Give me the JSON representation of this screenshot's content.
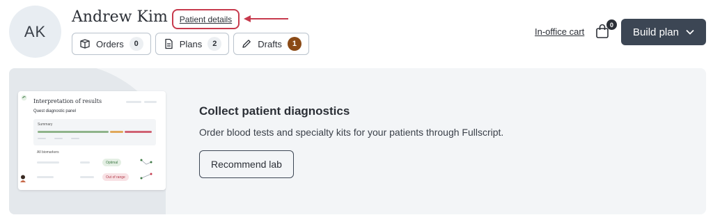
{
  "patient": {
    "initials": "AK",
    "name": "Andrew Kim",
    "details_link": "Patient details"
  },
  "tabs": [
    {
      "label": "Orders",
      "count": "0",
      "icon": "box-icon"
    },
    {
      "label": "Plans",
      "count": "2",
      "icon": "document-icon"
    },
    {
      "label": "Drafts",
      "count": "1",
      "icon": "pencil-icon"
    }
  ],
  "header": {
    "cart_label": "In-office cart",
    "cart_count": "0",
    "build_plan_label": "Build plan"
  },
  "banner": {
    "title": "Collect patient diagnostics",
    "description": "Order blood tests and specialty kits for your patients through Fullscript.",
    "button_label": "Recommend lab",
    "preview": {
      "title": "Interpretation of results",
      "subtitle": "Quest diagnostic panel",
      "summary_label": "Summary",
      "biomarkers_label": "All biomarkers",
      "optimal_label": "Optimal",
      "out_of_range_label": "Out of range"
    }
  },
  "colors": {
    "highlight": "#c73a4d",
    "primary_button": "#3c4654",
    "drafts_badge": "#8a4a16",
    "banner_bg": "#f3f5f7"
  }
}
